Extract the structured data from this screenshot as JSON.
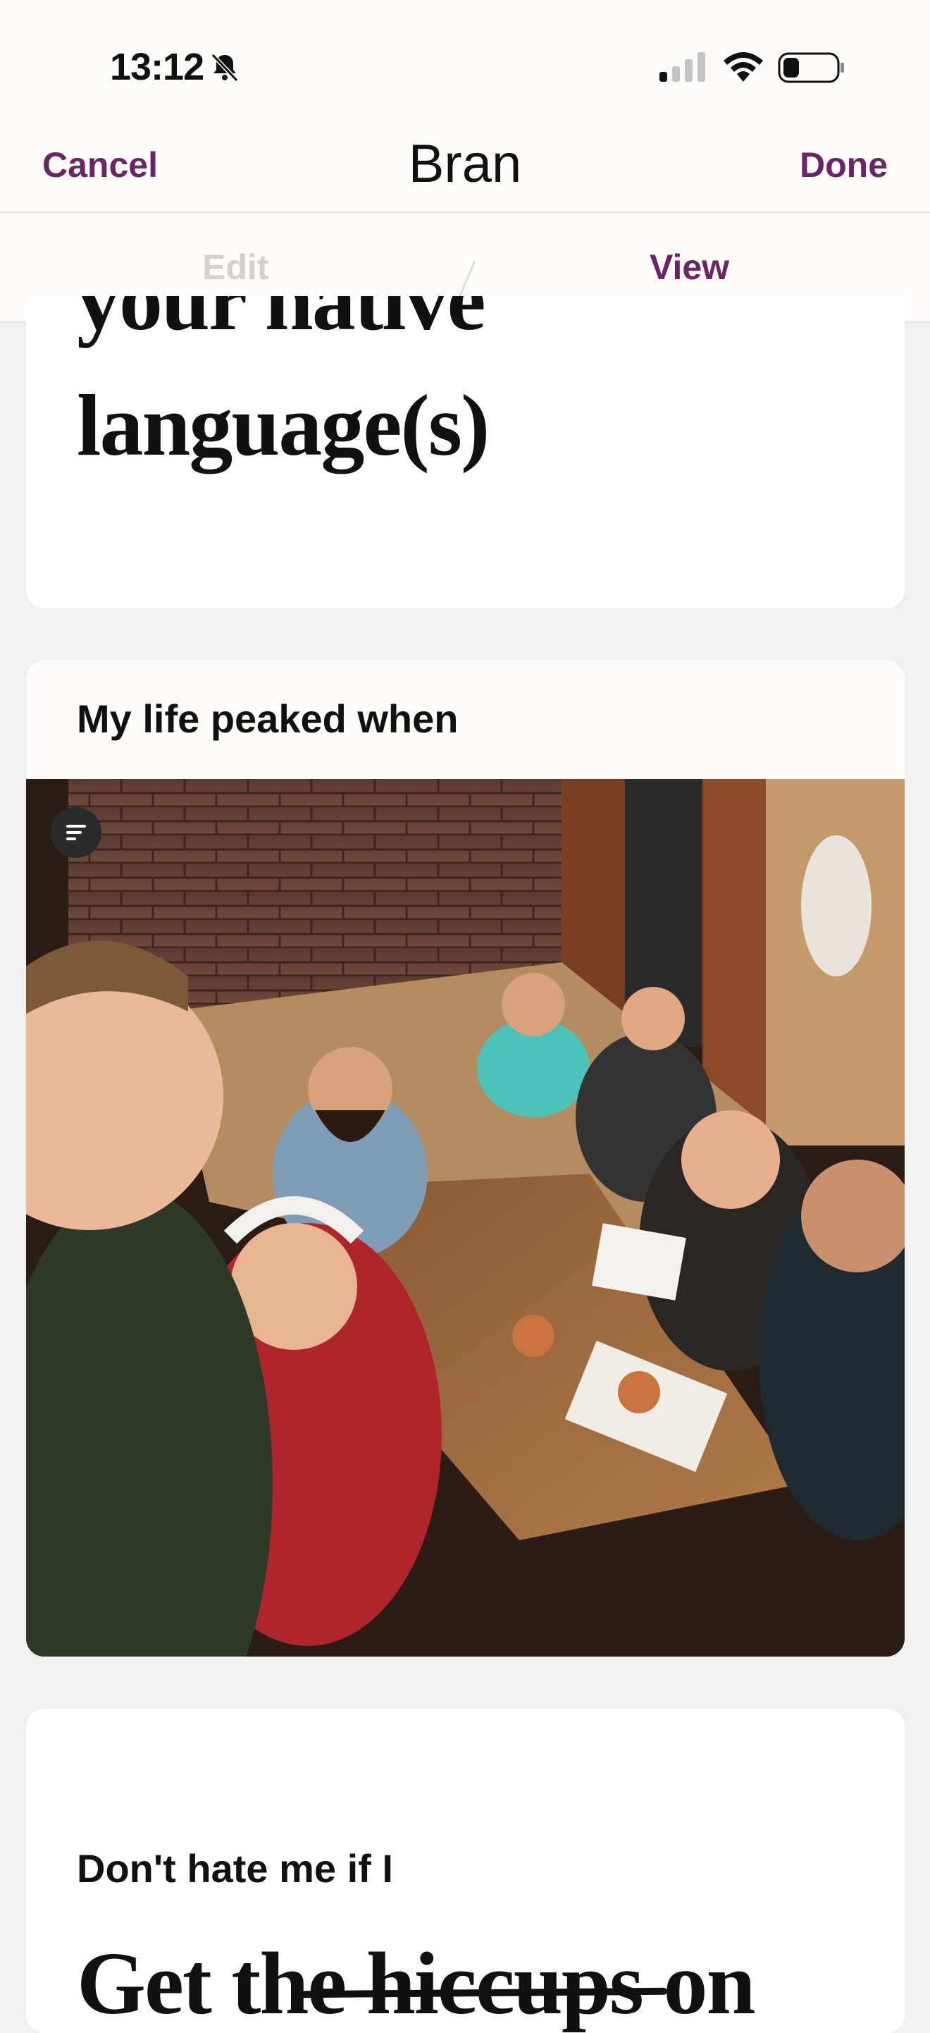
{
  "status_bar": {
    "time": "13:12"
  },
  "nav": {
    "cancel": "Cancel",
    "title": "Bran",
    "done": "Done"
  },
  "tabs": [
    {
      "label": "Edit",
      "active": false
    },
    {
      "label": "View",
      "active": true
    }
  ],
  "cards": {
    "native_language": {
      "answer_line1": "your native",
      "answer_line2": "language(s)"
    },
    "life_peaked": {
      "prompt": "My life peaked when",
      "photo_alt": "Group selfie at restaurant table"
    },
    "dont_hate": {
      "prompt": "Don't hate me if I",
      "answer": "Get the hiccups on"
    }
  },
  "colors": {
    "accent": "#6b2464",
    "tab_inactive": "#d4d1ce",
    "background": "#f0f0f0"
  }
}
